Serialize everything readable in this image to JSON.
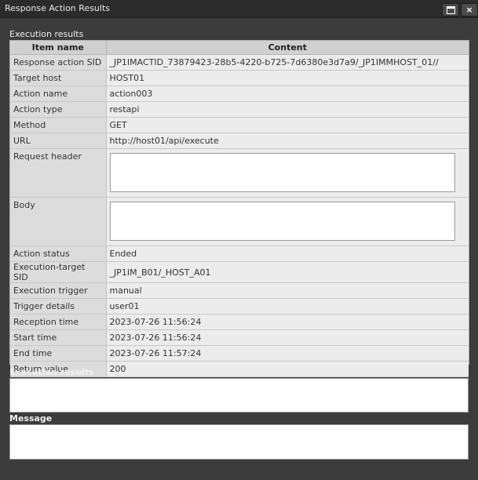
{
  "window": {
    "title": "Response Action Results",
    "maximize_icon": "maximize-icon",
    "close_label": "×"
  },
  "labels": {
    "execution_results_top": "Execution results",
    "execution_results_bottom": "Execution results",
    "message": "Message"
  },
  "table": {
    "headers": [
      "Item name",
      "Content"
    ],
    "rows": [
      {
        "name": "Response action SID",
        "value": "_JP1IMACTID_73879423-28b5-4220-b725-7d6380e3d7a9/_JP1IMMHOST_01//"
      },
      {
        "name": "Target host",
        "value": "HOST01"
      },
      {
        "name": "Action name",
        "value": "action003"
      },
      {
        "name": "Action type",
        "value": "restapi"
      },
      {
        "name": "Method",
        "value": "GET"
      },
      {
        "name": "URL",
        "value": "http://host01/api/execute"
      },
      {
        "name": "Request header",
        "value": ""
      },
      {
        "name": "Body",
        "value": ""
      },
      {
        "name": "Action status",
        "value": "Ended"
      },
      {
        "name": "Execution-target SID",
        "value": "_JP1IM_B01/_HOST_A01"
      },
      {
        "name": "Execution trigger",
        "value": "manual"
      },
      {
        "name": "Trigger details",
        "value": "user01"
      },
      {
        "name": "Reception time",
        "value": "2023-07-26 11:56:24"
      },
      {
        "name": "Start time",
        "value": "2023-07-26 11:56:24"
      },
      {
        "name": "End time",
        "value": "2023-07-26 11:57:24"
      },
      {
        "name": "Return value",
        "value": "200"
      }
    ]
  },
  "fields": {
    "execution_results_value": "",
    "message_value": ""
  }
}
